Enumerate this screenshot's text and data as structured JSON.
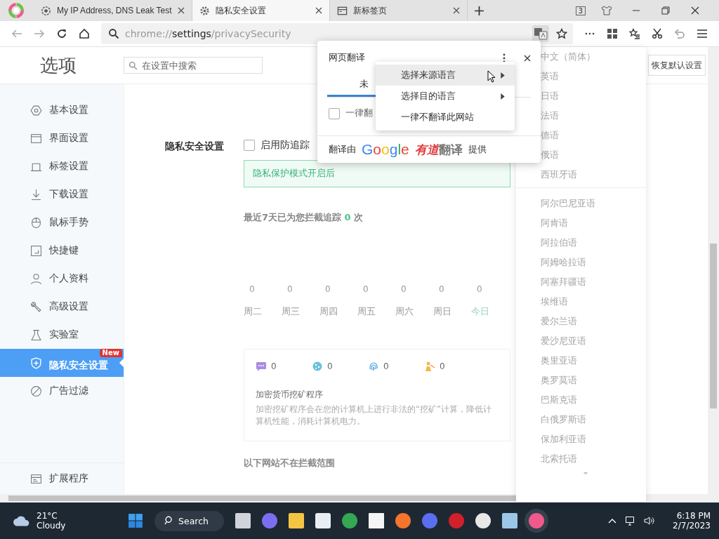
{
  "tabs": [
    {
      "title": "My IP Address, DNS Leak Test",
      "selected": false
    },
    {
      "title": "隐私安全设置",
      "selected": true
    },
    {
      "title": "新标签页",
      "selected": false
    }
  ],
  "tab_count": "3",
  "address_bar": {
    "scheme": "chrome://",
    "host": "settings",
    "path": "/privacySecurity"
  },
  "settings_page": {
    "title": "选项",
    "search_placeholder": "在设置中搜索",
    "restore_button": "恢复默认设置",
    "sidebar": {
      "items": [
        {
          "label": "基本设置",
          "selected": false
        },
        {
          "label": "界面设置",
          "selected": false
        },
        {
          "label": "标签设置",
          "selected": false
        },
        {
          "label": "下载设置",
          "selected": false
        },
        {
          "label": "鼠标手势",
          "selected": false
        },
        {
          "label": "快捷键",
          "selected": false
        },
        {
          "label": "个人资料",
          "selected": false
        },
        {
          "label": "高级设置",
          "selected": false
        },
        {
          "label": "实验室",
          "selected": false
        },
        {
          "label": "隐私安全设置",
          "selected": true,
          "badge": "New"
        },
        {
          "label": "广告过滤",
          "selected": false
        }
      ],
      "footer_item": "扩展程序"
    },
    "section_label": "隐私安全设置",
    "tracking_checkbox": {
      "label": "启用防追踪",
      "checked": false
    },
    "notice": "隐私保护模式开启后",
    "blocked_summary": {
      "prefix": "最近7天已为您拦截追踪",
      "count": "0",
      "suffix": "次"
    },
    "daily": [
      {
        "count": "0",
        "day": "周二",
        "today": false
      },
      {
        "count": "0",
        "day": "周三",
        "today": false
      },
      {
        "count": "0",
        "day": "周四",
        "today": false
      },
      {
        "count": "0",
        "day": "周五",
        "today": false
      },
      {
        "count": "0",
        "day": "周六",
        "today": false
      },
      {
        "count": "0",
        "day": "周日",
        "today": false
      },
      {
        "count": "0",
        "day": "今日",
        "today": true
      }
    ],
    "stats": [
      {
        "count": "0"
      },
      {
        "count": "0"
      },
      {
        "count": "0"
      },
      {
        "count": "0"
      }
    ],
    "threat_title": "加密货币挖矿程序",
    "threat_description": "加密挖矿程序会在您的计算机上进行非法的“挖矿”计算，降低计算机性能，消耗计算机电力。",
    "whitelist_heading": "以下网站不在拦截范围"
  },
  "translate_popup": {
    "title": "网页翻译",
    "tab": {
      "label": "未",
      "selected": true
    },
    "always_checkbox": {
      "label": "一律翻",
      "checked": false
    },
    "footer": {
      "prefix": "翻译由",
      "google": "Google",
      "youdao": "有道",
      "youdao_suffix": "翻译",
      "suffix": "提供"
    }
  },
  "context_menu": [
    {
      "label": "选择来源语言",
      "selected": true,
      "submenu": true
    },
    {
      "label": "选择目的语言",
      "selected": false,
      "submenu": true
    },
    {
      "label": "一律不翻译此网站",
      "selected": false,
      "submenu": false
    }
  ],
  "language_list": {
    "recent": [
      "中文（简体）",
      "英语",
      "日语",
      "法语",
      "德语",
      "俄语",
      "西班牙语"
    ],
    "all": [
      "阿尔巴尼亚语",
      "阿肯语",
      "阿拉伯语",
      "阿姆哈拉语",
      "阿塞拜疆语",
      "埃维语",
      "爱尔兰语",
      "爱沙尼亚语",
      "奥里亚语",
      "奥罗莫语",
      "巴斯克语",
      "白俄罗斯语",
      "保加利亚语",
      "北索托语"
    ]
  },
  "taskbar": {
    "temperature": "21°C",
    "condition": "Cloudy",
    "search": "Search",
    "time": "6:18 PM",
    "date": "2/7/2023"
  }
}
